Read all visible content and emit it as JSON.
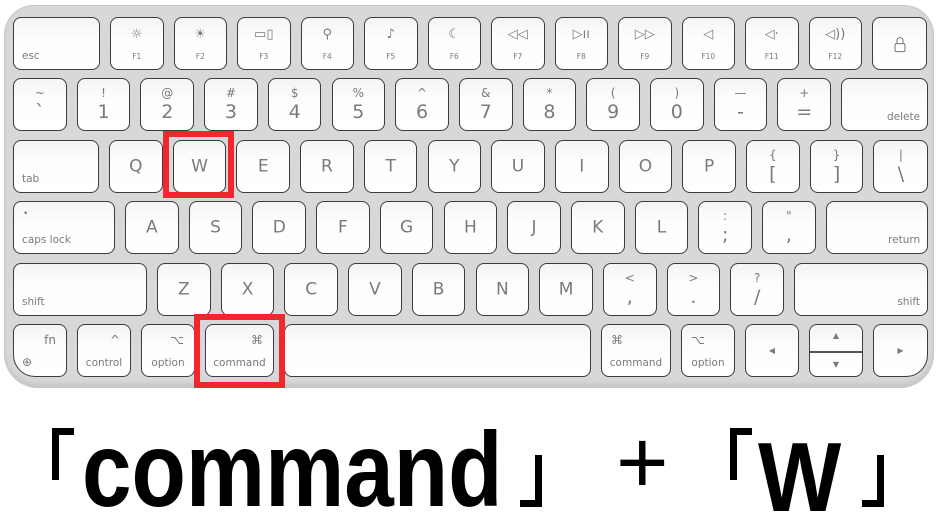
{
  "keyboard": {
    "rows": [
      [
        {
          "type": "mod-bl",
          "label": "esc"
        },
        {
          "type": "fn",
          "label": "F1",
          "icon": "brightness-down-icon"
        },
        {
          "type": "fn",
          "label": "F2",
          "icon": "brightness-up-icon"
        },
        {
          "type": "fn",
          "label": "F3",
          "icon": "mission-control-icon"
        },
        {
          "type": "fn",
          "label": "F4",
          "icon": "search-icon"
        },
        {
          "type": "fn",
          "label": "F5",
          "icon": "microphone-icon"
        },
        {
          "type": "fn",
          "label": "F6",
          "icon": "moon-icon"
        },
        {
          "type": "fn",
          "label": "F7",
          "icon": "rewind-icon"
        },
        {
          "type": "fn",
          "label": "F8",
          "icon": "play-pause-icon"
        },
        {
          "type": "fn",
          "label": "F9",
          "icon": "fast-forward-icon"
        },
        {
          "type": "fn",
          "label": "F10",
          "icon": "mute-icon"
        },
        {
          "type": "fn",
          "label": "F11",
          "icon": "volume-down-icon"
        },
        {
          "type": "fn",
          "label": "F12",
          "icon": "volume-up-icon"
        },
        {
          "type": "lock",
          "icon": "lock-icon"
        }
      ],
      [
        {
          "type": "dual",
          "top": "~",
          "label": "`"
        },
        {
          "type": "dual",
          "top": "!",
          "label": "1"
        },
        {
          "type": "dual",
          "top": "@",
          "label": "2"
        },
        {
          "type": "dual",
          "top": "#",
          "label": "3"
        },
        {
          "type": "dual",
          "top": "$",
          "label": "4"
        },
        {
          "type": "dual",
          "top": "%",
          "label": "5"
        },
        {
          "type": "dual",
          "top": "^",
          "label": "6"
        },
        {
          "type": "dual",
          "top": "&",
          "label": "7"
        },
        {
          "type": "dual",
          "top": "*",
          "label": "8"
        },
        {
          "type": "dual",
          "top": "(",
          "label": "9"
        },
        {
          "type": "dual",
          "top": ")",
          "label": "0"
        },
        {
          "type": "dual",
          "top": "—",
          "label": "-"
        },
        {
          "type": "dual",
          "top": "+",
          "label": "="
        },
        {
          "type": "mod-br",
          "label": "delete"
        }
      ],
      [
        {
          "type": "mod-bl",
          "label": "tab"
        },
        {
          "type": "letter",
          "label": "Q"
        },
        {
          "type": "letter",
          "label": "W"
        },
        {
          "type": "letter",
          "label": "E"
        },
        {
          "type": "letter",
          "label": "R"
        },
        {
          "type": "letter",
          "label": "T"
        },
        {
          "type": "letter",
          "label": "Y"
        },
        {
          "type": "letter",
          "label": "U"
        },
        {
          "type": "letter",
          "label": "I"
        },
        {
          "type": "letter",
          "label": "O"
        },
        {
          "type": "letter",
          "label": "P"
        },
        {
          "type": "dual",
          "top": "{",
          "label": "["
        },
        {
          "type": "dual",
          "top": "}",
          "label": "]"
        },
        {
          "type": "dual",
          "top": "|",
          "label": "\\"
        }
      ],
      [
        {
          "type": "caps",
          "label": "caps lock",
          "icon": "caps-lock-indicator-icon"
        },
        {
          "type": "letter",
          "label": "A"
        },
        {
          "type": "letter",
          "label": "S"
        },
        {
          "type": "letter",
          "label": "D"
        },
        {
          "type": "letter",
          "label": "F"
        },
        {
          "type": "letter",
          "label": "G"
        },
        {
          "type": "letter",
          "label": "H"
        },
        {
          "type": "letter",
          "label": "J"
        },
        {
          "type": "letter",
          "label": "K"
        },
        {
          "type": "letter",
          "label": "L"
        },
        {
          "type": "dual",
          "top": ":",
          "label": ";"
        },
        {
          "type": "dual",
          "top": "\"",
          "label": ","
        },
        {
          "type": "mod-br",
          "label": "return"
        }
      ],
      [
        {
          "type": "mod-bl",
          "label": "shift"
        },
        {
          "type": "letter",
          "label": "Z"
        },
        {
          "type": "letter",
          "label": "X"
        },
        {
          "type": "letter",
          "label": "C"
        },
        {
          "type": "letter",
          "label": "V"
        },
        {
          "type": "letter",
          "label": "B"
        },
        {
          "type": "letter",
          "label": "N"
        },
        {
          "type": "letter",
          "label": "M"
        },
        {
          "type": "dual",
          "top": "<",
          "label": ","
        },
        {
          "type": "dual",
          "top": ">",
          "label": "."
        },
        {
          "type": "dual",
          "top": "?",
          "label": "/"
        },
        {
          "type": "mod-br",
          "label": "shift"
        }
      ],
      [
        {
          "type": "fnkey",
          "label": "fn",
          "icon": "globe-icon"
        },
        {
          "type": "mod-sym-r",
          "label": "control",
          "symbol": "^"
        },
        {
          "type": "mod-sym-r",
          "label": "option",
          "symbol": "⌥"
        },
        {
          "type": "mod-sym-r",
          "label": "command",
          "symbol": "⌘"
        },
        {
          "type": "space"
        },
        {
          "type": "mod-sym-l",
          "label": "command",
          "symbol": "⌘"
        },
        {
          "type": "mod-sym-l",
          "label": "option",
          "symbol": "⌥"
        },
        {
          "type": "arrow",
          "icon": "arrow-left-icon"
        },
        {
          "type": "updown",
          "icon": "arrow-up-down-icon"
        },
        {
          "type": "arrow",
          "icon": "arrow-right-icon"
        }
      ]
    ],
    "highlighted_keys": [
      "W",
      "command"
    ],
    "highlight_color": "#f0282d"
  },
  "caption": {
    "key1": "command",
    "plus": "+",
    "key2": "W"
  }
}
